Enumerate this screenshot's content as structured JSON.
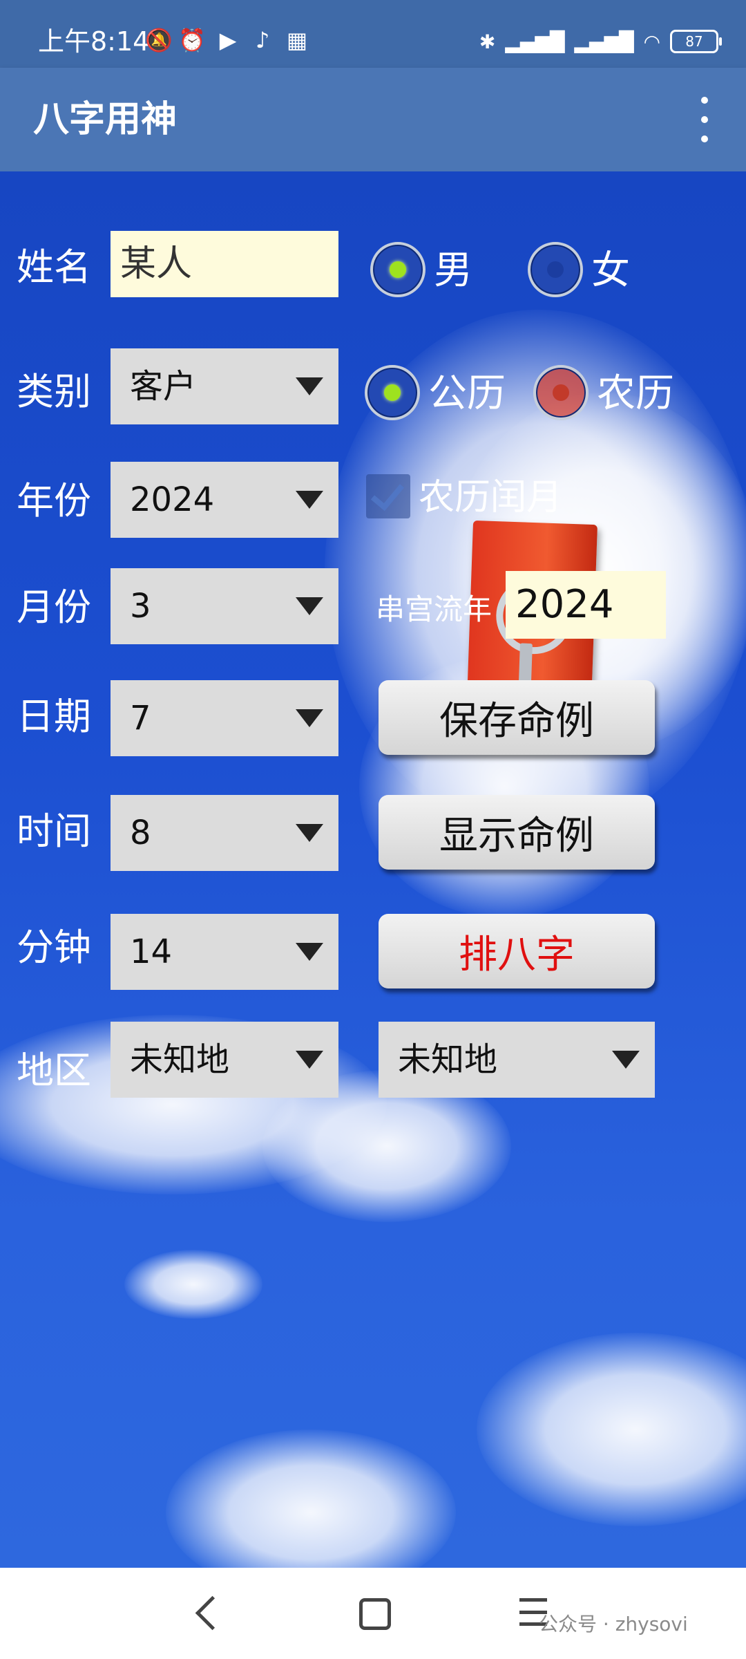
{
  "status_bar": {
    "time": "上午8:14",
    "icons": [
      "mute-bell-icon",
      "alarm-icon",
      "play-store-icon",
      "tiktok-icon",
      "calendar-icon",
      "bluetooth-icon",
      "signal-hd-1-icon",
      "signal-hd-2-icon",
      "wifi-icon"
    ],
    "battery": "87"
  },
  "app_bar": {
    "title": "八字用神",
    "menu_icon": "overflow-menu-icon"
  },
  "form": {
    "name": {
      "label": "姓名",
      "value": "某人"
    },
    "gender": {
      "male": "男",
      "female": "女",
      "selected": "male"
    },
    "category": {
      "label": "类别",
      "value": "客户"
    },
    "calendar": {
      "solar": "公历",
      "lunar": "农历",
      "selected": "solar"
    },
    "year": {
      "label": "年份",
      "value": "2024"
    },
    "leap_month": {
      "label": "农历闰月",
      "checked": true
    },
    "month": {
      "label": "月份",
      "value": "3"
    },
    "flow_year": {
      "label": "串宫流年",
      "value": "2024"
    },
    "day": {
      "label": "日期",
      "value": "7"
    },
    "hour": {
      "label": "时间",
      "value": "8"
    },
    "minute": {
      "label": "分钟",
      "value": "14"
    },
    "region": {
      "label": "地区",
      "value1": "未知地",
      "value2": "未知地"
    }
  },
  "buttons": {
    "save": "保存命例",
    "show": "显示命例",
    "bazi": "排八字"
  },
  "colors": {
    "status_bar": "#3f6aa8",
    "app_bar": "#4b76b5",
    "sky": "#1c4fd1",
    "bazi_text": "#e01010",
    "radio_on": "#9ee21f"
  },
  "watermark": "公众号 · zhysovi"
}
